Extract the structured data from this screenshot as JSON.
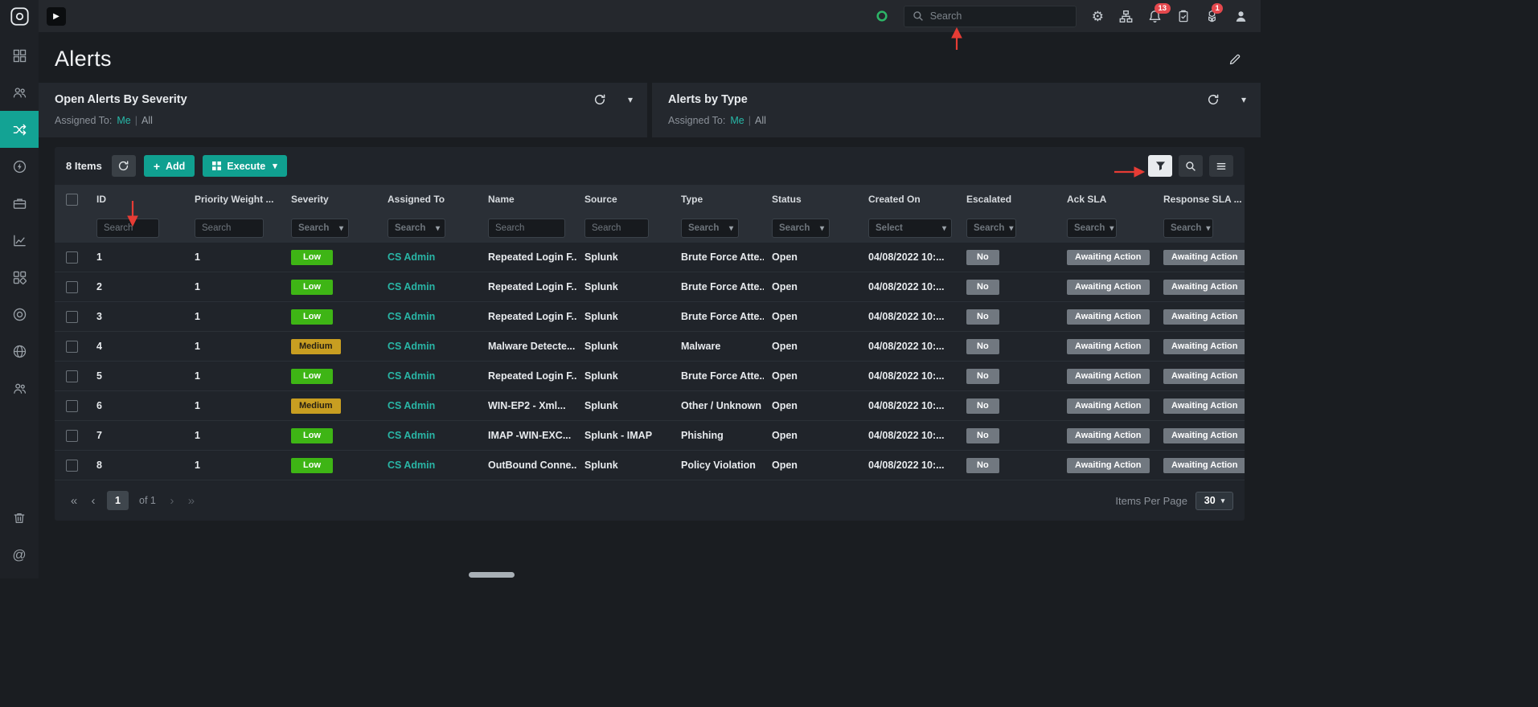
{
  "colors": {
    "accent_teal": "#10a090",
    "severity_low": "#3eb515",
    "severity_medium": "#c89e21",
    "badge_gray": "#717880",
    "notification_red": "#e5484d",
    "annotation_red": "#e63c35"
  },
  "icons": {
    "play": "▶",
    "gear": "⚙",
    "caret_down": "▾",
    "plus": "+",
    "pipe": "|",
    "at_sign": "@",
    "page_first": "«",
    "page_prev": "‹",
    "page_next": "›",
    "page_last": "»"
  },
  "topbar": {
    "search_placeholder": "Search",
    "notifications_badge": "13",
    "packages_badge": "1"
  },
  "page": {
    "title": "Alerts"
  },
  "widgets": {
    "left": {
      "title": "Open Alerts By Severity",
      "assigned_to_label": "Assigned To:",
      "me": "Me",
      "all": "All"
    },
    "right": {
      "title": "Alerts by Type",
      "assigned_to_label": "Assigned To:",
      "me": "Me",
      "all": "All"
    }
  },
  "toolbar": {
    "items_count": "8 Items",
    "add_label": "Add",
    "execute_label": "Execute"
  },
  "table": {
    "columns": [
      {
        "label": "ID",
        "filter": "input",
        "placeholder": "Search"
      },
      {
        "label": "Priority Weight ...",
        "filter": "input",
        "placeholder": "Search"
      },
      {
        "label": "Severity",
        "filter": "select",
        "placeholder": "Search"
      },
      {
        "label": "Assigned To",
        "filter": "select",
        "placeholder": "Search"
      },
      {
        "label": "Name",
        "filter": "input",
        "placeholder": "Search"
      },
      {
        "label": "Source",
        "filter": "input",
        "placeholder": "Search"
      },
      {
        "label": "Type",
        "filter": "select",
        "placeholder": "Search"
      },
      {
        "label": "Status",
        "filter": "select",
        "placeholder": "Search"
      },
      {
        "label": "Created On",
        "filter": "select",
        "placeholder": "Select"
      },
      {
        "label": "Escalated",
        "filter": "select",
        "placeholder": "Search"
      },
      {
        "label": "Ack SLA",
        "filter": "select",
        "placeholder": "Search"
      },
      {
        "label": "Response SLA ...",
        "filter": "select",
        "placeholder": "Search"
      }
    ],
    "rows": [
      {
        "id": "1",
        "priority_weight": "1",
        "severity": "Low",
        "severity_level": "low",
        "assigned_to": "CS Admin",
        "name": "Repeated Login F...",
        "source": "Splunk",
        "type": "Brute Force Atte...",
        "status": "Open",
        "created_on": "04/08/2022 10:...",
        "escalated": "No",
        "ack_sla": "Awaiting Action",
        "response_sla": "Awaiting Action"
      },
      {
        "id": "2",
        "priority_weight": "1",
        "severity": "Low",
        "severity_level": "low",
        "assigned_to": "CS Admin",
        "name": "Repeated Login F...",
        "source": "Splunk",
        "type": "Brute Force Atte...",
        "status": "Open",
        "created_on": "04/08/2022 10:...",
        "escalated": "No",
        "ack_sla": "Awaiting Action",
        "response_sla": "Awaiting Action"
      },
      {
        "id": "3",
        "priority_weight": "1",
        "severity": "Low",
        "severity_level": "low",
        "assigned_to": "CS Admin",
        "name": "Repeated Login F...",
        "source": "Splunk",
        "type": "Brute Force Atte...",
        "status": "Open",
        "created_on": "04/08/2022 10:...",
        "escalated": "No",
        "ack_sla": "Awaiting Action",
        "response_sla": "Awaiting Action"
      },
      {
        "id": "4",
        "priority_weight": "1",
        "severity": "Medium",
        "severity_level": "medium",
        "assigned_to": "CS Admin",
        "name": "Malware Detecte...",
        "source": "Splunk",
        "type": "Malware",
        "status": "Open",
        "created_on": "04/08/2022 10:...",
        "escalated": "No",
        "ack_sla": "Awaiting Action",
        "response_sla": "Awaiting Action"
      },
      {
        "id": "5",
        "priority_weight": "1",
        "severity": "Low",
        "severity_level": "low",
        "assigned_to": "CS Admin",
        "name": "Repeated Login F...",
        "source": "Splunk",
        "type": "Brute Force Atte...",
        "status": "Open",
        "created_on": "04/08/2022 10:...",
        "escalated": "No",
        "ack_sla": "Awaiting Action",
        "response_sla": "Awaiting Action"
      },
      {
        "id": "6",
        "priority_weight": "1",
        "severity": "Medium",
        "severity_level": "medium",
        "assigned_to": "CS Admin",
        "name": "WIN-EP2 - Xml...",
        "source": "Splunk",
        "type": "Other / Unknown",
        "status": "Open",
        "created_on": "04/08/2022 10:...",
        "escalated": "No",
        "ack_sla": "Awaiting Action",
        "response_sla": "Awaiting Action"
      },
      {
        "id": "7",
        "priority_weight": "1",
        "severity": "Low",
        "severity_level": "low",
        "assigned_to": "CS Admin",
        "name": "IMAP -WIN-EXC...",
        "source": "Splunk - IMAP",
        "type": "Phishing",
        "status": "Open",
        "created_on": "04/08/2022 10:...",
        "escalated": "No",
        "ack_sla": "Awaiting Action",
        "response_sla": "Awaiting Action"
      },
      {
        "id": "8",
        "priority_weight": "1",
        "severity": "Low",
        "severity_level": "low",
        "assigned_to": "CS Admin",
        "name": "OutBound Conne...",
        "source": "Splunk",
        "type": "Policy Violation",
        "status": "Open",
        "created_on": "04/08/2022 10:...",
        "escalated": "No",
        "ack_sla": "Awaiting Action",
        "response_sla": "Awaiting Action"
      }
    ]
  },
  "pagination": {
    "current_page": "1",
    "of_label": "of 1",
    "items_per_page_label": "Items Per Page",
    "items_per_page_value": "30"
  }
}
